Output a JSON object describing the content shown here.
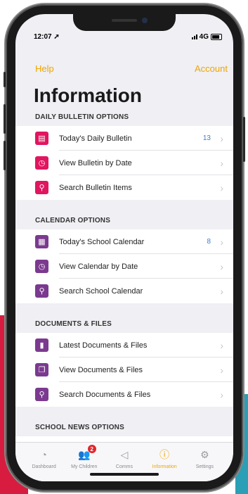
{
  "status": {
    "time": "12:07",
    "network": "4G"
  },
  "nav": {
    "help": "Help",
    "account": "Account"
  },
  "page_title": "Information",
  "sections": [
    {
      "header": "DAILY BULLETIN OPTIONS",
      "items": [
        {
          "label": "Today's Daily Bulletin",
          "count": "13",
          "icon": "document-icon",
          "color": "#e0165f"
        },
        {
          "label": "View Bulletin by Date",
          "count": "",
          "icon": "calendar-clock-icon",
          "color": "#e0165f"
        },
        {
          "label": "Search Bulletin Items",
          "count": "",
          "icon": "search-icon",
          "color": "#e0165f"
        }
      ]
    },
    {
      "header": "CALENDAR OPTIONS",
      "items": [
        {
          "label": "Today's School Calendar",
          "count": "8",
          "icon": "calendar-icon",
          "color": "#7b3a8f"
        },
        {
          "label": "View Calendar by Date",
          "count": "",
          "icon": "calendar-clock-icon",
          "color": "#7b3a8f"
        },
        {
          "label": "Search School Calendar",
          "count": "",
          "icon": "search-icon",
          "color": "#7b3a8f"
        }
      ]
    },
    {
      "header": "DOCUMENTS & FILES",
      "items": [
        {
          "label": "Latest Documents & Files",
          "count": "",
          "icon": "file-icon",
          "color": "#7b3a8f"
        },
        {
          "label": "View Documents & Files",
          "count": "",
          "icon": "files-icon",
          "color": "#7b3a8f"
        },
        {
          "label": "Search Documents & Files",
          "count": "",
          "icon": "search-icon",
          "color": "#7b3a8f"
        }
      ]
    },
    {
      "header": "SCHOOL NEWS OPTIONS",
      "items": []
    }
  ],
  "tabs": [
    {
      "label": "Dashboard",
      "icon": "dashboard-icon",
      "active": false,
      "badge": ""
    },
    {
      "label": "My Children",
      "icon": "children-icon",
      "active": false,
      "badge": "2"
    },
    {
      "label": "Comms",
      "icon": "megaphone-icon",
      "active": false,
      "badge": ""
    },
    {
      "label": "Information",
      "icon": "info-icon",
      "active": true,
      "badge": ""
    },
    {
      "label": "Settings",
      "icon": "gear-icon",
      "active": false,
      "badge": ""
    }
  ],
  "colors": {
    "accent": "#f0a500",
    "bulletin": "#e0165f",
    "calendar": "#7b3a8f",
    "count": "#3b7fc4"
  }
}
